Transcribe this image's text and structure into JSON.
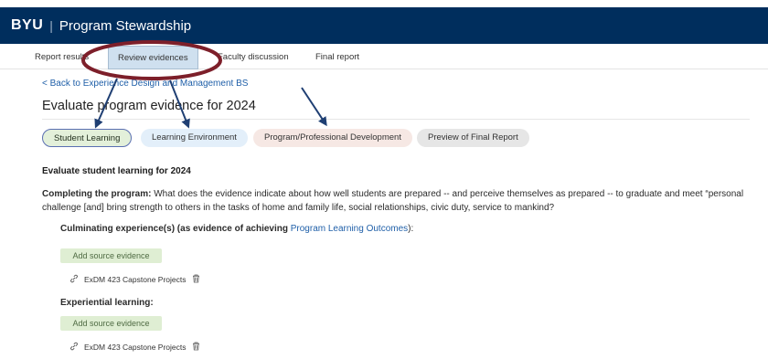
{
  "header": {
    "logo": "BYU",
    "separator": "|",
    "title": "Program Stewardship"
  },
  "tabs": [
    {
      "label": "Report results"
    },
    {
      "label": "Review evidences"
    },
    {
      "label": "Faculty discussion"
    },
    {
      "label": "Final report"
    }
  ],
  "back_link": "< Back to Experience Design and Management BS",
  "page_title": "Evaluate program evidence for 2024",
  "pills": [
    {
      "label": "Student Learning"
    },
    {
      "label": "Learning Environment"
    },
    {
      "label": "Program/Professional Development"
    },
    {
      "label": "Preview of Final Report"
    }
  ],
  "section_heading": "Evaluate student learning for 2024",
  "completing": {
    "lead": "Completing the program:",
    "text": " What does the evidence indicate about how well students are prepared -- and perceive themselves as prepared -- to graduate and meet “personal challenge [and] bring strength to others in the tasks of home and family life, social relationships, civic duty, service to mankind?"
  },
  "culminating": {
    "heading": "Culminating experience(s) (as evidence of achieving ",
    "link": "Program Learning Outcomes",
    "tail": "):",
    "add_label": "Add source evidence",
    "evidence": "ExDM 423 Capstone Projects"
  },
  "experiential": {
    "heading": "Experiential learning:",
    "add_label": "Add source evidence",
    "evidence": "ExDM 423 Capstone Projects"
  },
  "annotation_color": "#7d1f2a",
  "arrow_color": "#1f3f73"
}
